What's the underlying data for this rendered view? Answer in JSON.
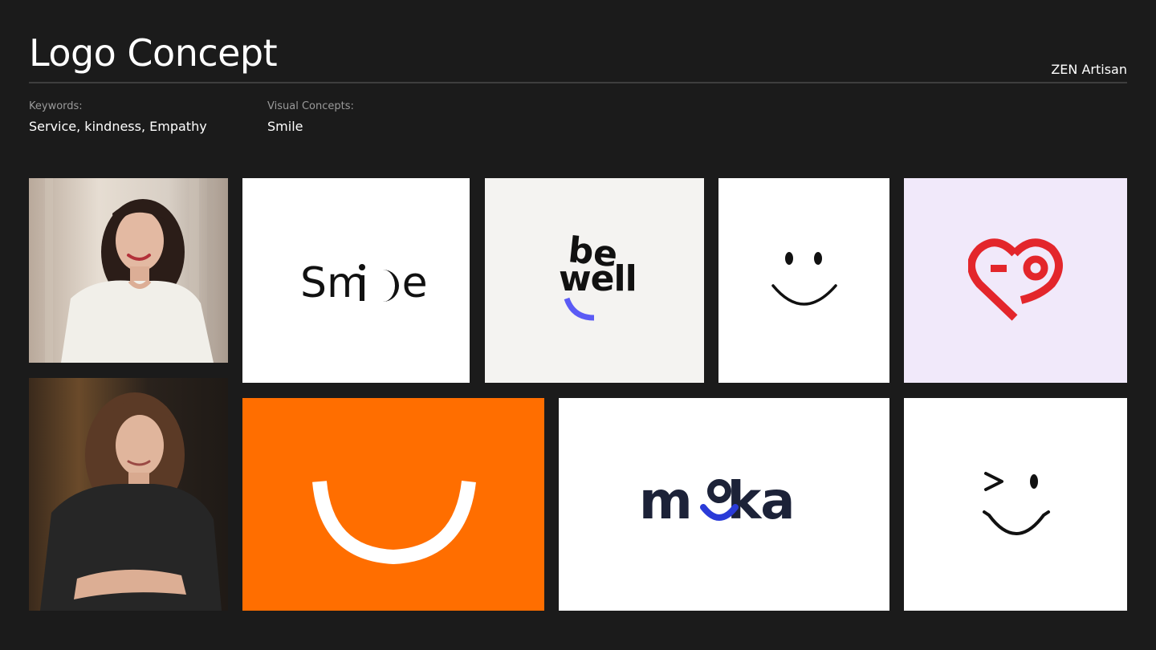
{
  "header": {
    "title": "Logo Concept",
    "brand": "ZEN Artisan"
  },
  "meta": {
    "keywords_label": "Keywords:",
    "keywords_value": "Service, kindness, Empathy",
    "visual_label": "Visual Concepts:",
    "visual_value": "Smile"
  },
  "logos": {
    "smile": {
      "text_start": "Sm",
      "text_i": "i",
      "text_end": "e",
      "bg": "#ffffff"
    },
    "bewell": {
      "line1": "be",
      "line2": "well",
      "bg": "#f4f3f1",
      "accent": "#5b5bf5"
    },
    "smiley_face": {
      "bg": "#ffffff"
    },
    "heart": {
      "bg": "#f1e9fa",
      "accent": "#e3262b"
    },
    "orange_smile": {
      "bg": "#ff6e00"
    },
    "moka": {
      "text_m": "m",
      "text_rest": "ka",
      "bg": "#ffffff",
      "text_color": "#1c2238",
      "accent": "#2a3bd8"
    },
    "wink": {
      "bg": "#ffffff"
    }
  },
  "photos": [
    {
      "name": "woman-photo-1",
      "description_icon": "person-photo"
    },
    {
      "name": "woman-photo-2",
      "description_icon": "person-photo"
    }
  ]
}
